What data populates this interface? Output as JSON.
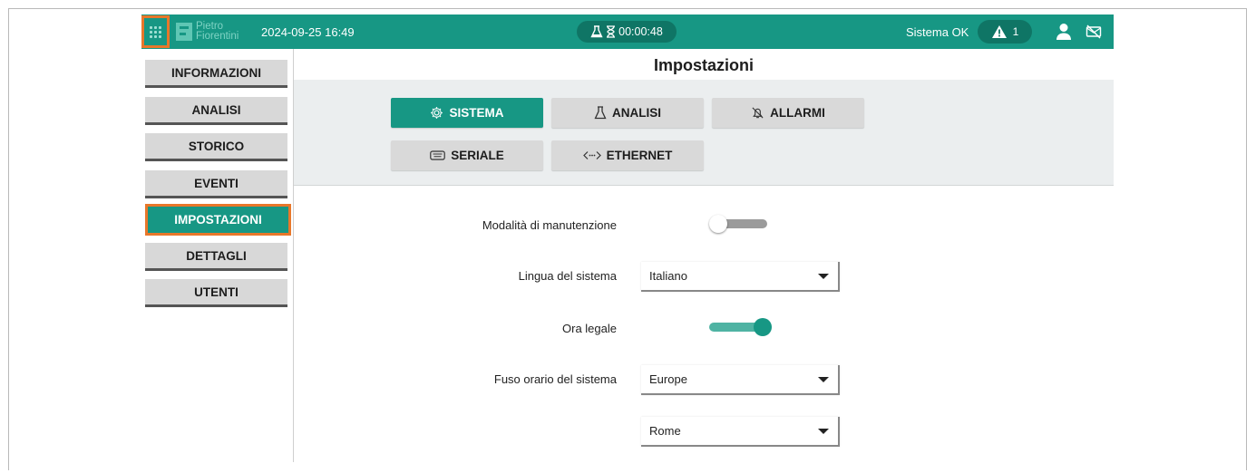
{
  "header": {
    "logo_line1": "Pietro",
    "logo_line2": "Fiorentini",
    "datetime": "2024-09-25 16:49",
    "timer": "00:00:48",
    "status": "Sistema OK",
    "alarm_count": "1",
    "icons": [
      "apps-grid-icon",
      "flask-icon",
      "hourglass-icon",
      "warning-icon",
      "user-icon",
      "connection-off-icon"
    ]
  },
  "sidebar": {
    "items": [
      {
        "label": "INFORMAZIONI",
        "active": false
      },
      {
        "label": "ANALISI",
        "active": false
      },
      {
        "label": "STORICO",
        "active": false
      },
      {
        "label": "EVENTI",
        "active": false
      },
      {
        "label": "IMPOSTAZIONI",
        "active": true
      },
      {
        "label": "DETTAGLI",
        "active": false
      },
      {
        "label": "UTENTI",
        "active": false
      }
    ]
  },
  "main": {
    "title": "Impostazioni",
    "tabs": [
      {
        "label": "SISTEMA",
        "icon": "gear-icon",
        "active": true
      },
      {
        "label": "ANALISI",
        "icon": "flask-icon",
        "active": false
      },
      {
        "label": "ALLARMI",
        "icon": "bell-off-icon",
        "active": false
      },
      {
        "label": "SERIALE",
        "icon": "serial-port-icon",
        "active": false
      },
      {
        "label": "ETHERNET",
        "icon": "ethernet-icon",
        "active": false
      }
    ],
    "form": {
      "maintenance_label": "Modalità di manutenzione",
      "maintenance_on": false,
      "language_label": "Lingua del sistema",
      "language_value": "Italiano",
      "dst_label": "Ora legale",
      "dst_on": true,
      "timezone_label": "Fuso orario del sistema",
      "timezone_region": "Europe",
      "timezone_city": "Rome"
    }
  },
  "colors": {
    "brand": "#179784",
    "brand_dark": "#0f7565",
    "highlight": "#e8772a",
    "button_gray": "#d9d9d9"
  }
}
